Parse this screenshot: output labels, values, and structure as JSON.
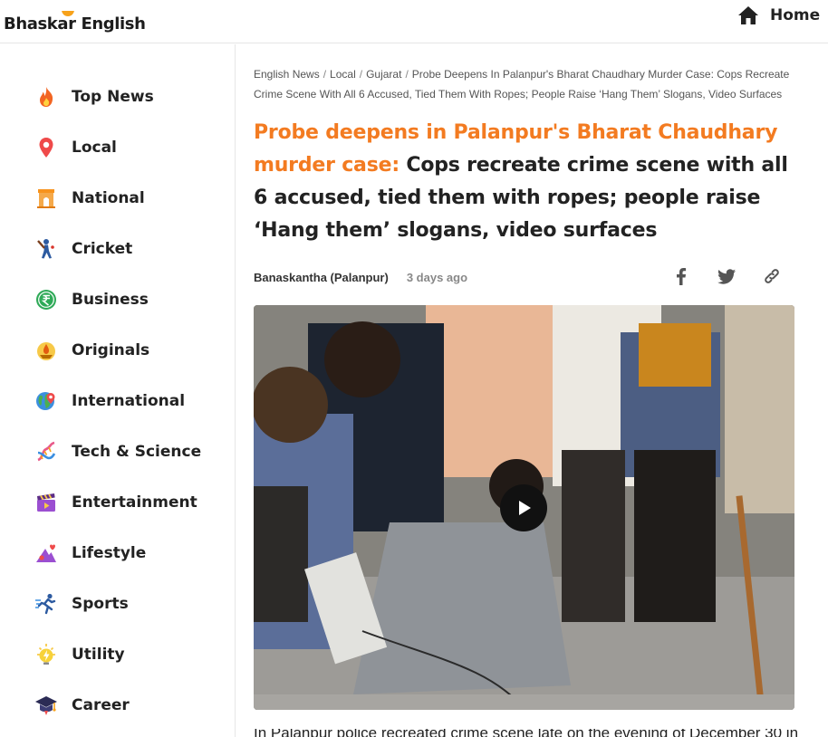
{
  "header": {
    "logo_text": "Bhaskar English",
    "home_label": "Home",
    "accent_color": "#f37b21",
    "logo_sun_color": "#f7a21b"
  },
  "sidebar": {
    "items": [
      {
        "label": "Top News",
        "icon": "flame-icon"
      },
      {
        "label": "Local",
        "icon": "location-pin-icon"
      },
      {
        "label": "National",
        "icon": "india-gate-icon"
      },
      {
        "label": "Cricket",
        "icon": "cricket-player-icon"
      },
      {
        "label": "Business",
        "icon": "rupee-icon"
      },
      {
        "label": "Originals",
        "icon": "lamp-icon"
      },
      {
        "label": "International",
        "icon": "globe-icon"
      },
      {
        "label": "Tech & Science",
        "icon": "dna-icon"
      },
      {
        "label": "Entertainment",
        "icon": "clapperboard-icon"
      },
      {
        "label": "Lifestyle",
        "icon": "lifestyle-icon"
      },
      {
        "label": "Sports",
        "icon": "runner-icon"
      },
      {
        "label": "Utility",
        "icon": "lightning-bulb-icon"
      },
      {
        "label": "Career",
        "icon": "graduation-cap-icon"
      }
    ]
  },
  "article": {
    "breadcrumb": [
      "English News",
      "Local",
      "Gujarat",
      "Probe Deepens In Palanpur's Bharat Chaudhary Murder Case: Cops Recreate Crime Scene With All 6 Accused, Tied Them With Ropes; People Raise ‘Hang Them’ Slogans, Video Surfaces"
    ],
    "headline_accent": "Probe deepens in Palanpur's Bharat Chaudhary murder case:",
    "headline_rest": "Cops recreate crime scene with all 6 accused, tied them with ropes; people raise ‘Hang them’ slogans, video surfaces",
    "location": "Banaskantha (Palanpur)",
    "time": "3 days ago",
    "share_icons": [
      "facebook-icon",
      "twitter-icon",
      "link-icon"
    ],
    "video_icon": "play-icon",
    "body_first_line": "In Palanpur police recreated crime scene late on the evening of December 30 in"
  }
}
